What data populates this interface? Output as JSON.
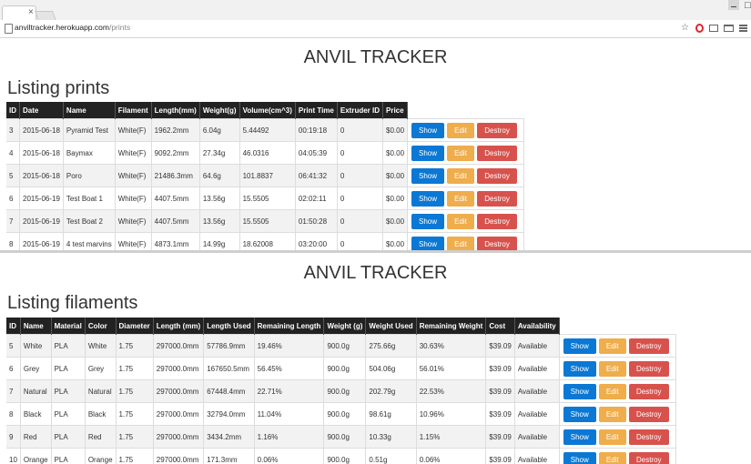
{
  "browser": {
    "url_host": "anviltracker.herokuapp.com",
    "url_path": "/prints",
    "tab_close": "×",
    "max_glyph": "□"
  },
  "prints_page": {
    "title": "ANVIL TRACKER",
    "heading": "Listing prints",
    "columns": [
      "ID",
      "Date",
      "Name",
      "Filament",
      "Length(mm)",
      "Weight(g)",
      "Volume(cm^3)",
      "Print Time",
      "Extruder ID",
      "Price"
    ],
    "rows": [
      [
        "3",
        "2015-06-18",
        "Pyramid Test",
        "White(F)",
        "1962.2mm",
        "6.04g",
        "5.44492",
        "00:19:18",
        "0",
        "$0.00"
      ],
      [
        "4",
        "2015-06-18",
        "Baymax",
        "White(F)",
        "9092.2mm",
        "27.34g",
        "46.0316",
        "04:05:39",
        "0",
        "$0.00"
      ],
      [
        "5",
        "2015-06-18",
        "Poro",
        "White(F)",
        "21486.3mm",
        "64.6g",
        "101.8837",
        "06:41:32",
        "0",
        "$0.00"
      ],
      [
        "6",
        "2015-06-19",
        "Test Boat 1",
        "White(F)",
        "4407.5mm",
        "13.56g",
        "15.5505",
        "02:02:11",
        "0",
        "$0.00"
      ],
      [
        "7",
        "2015-06-19",
        "Test Boat 2",
        "White(F)",
        "4407.5mm",
        "13.56g",
        "15.5505",
        "01:50:28",
        "0",
        "$0.00"
      ],
      [
        "8",
        "2015-06-19",
        "4 test marvins",
        "White(F)",
        "4873.1mm",
        "14.99g",
        "18.62008",
        "03:20:00",
        "0",
        "$0.00"
      ]
    ]
  },
  "filaments_page": {
    "title": "ANVIL TRACKER",
    "heading": "Listing filaments",
    "columns": [
      "ID",
      "Name",
      "Material",
      "Color",
      "Diameter",
      "Length (mm)",
      "Length Used",
      "Remaining Length",
      "Weight (g)",
      "Weight Used",
      "Remaining Weight",
      "Cost",
      "Availability"
    ],
    "rows": [
      [
        "5",
        "White",
        "PLA",
        "White",
        "1.75",
        "297000.0mm",
        "57786.9mm",
        "19.46%",
        "900.0g",
        "275.66g",
        "30.63%",
        "$39.09",
        "Available"
      ],
      [
        "6",
        "Grey",
        "PLA",
        "Grey",
        "1.75",
        "297000.0mm",
        "167650.5mm",
        "56.45%",
        "900.0g",
        "504.06g",
        "56.01%",
        "$39.09",
        "Available"
      ],
      [
        "7",
        "Natural",
        "PLA",
        "Natural",
        "1.75",
        "297000.0mm",
        "67448.4mm",
        "22.71%",
        "900.0g",
        "202.79g",
        "22.53%",
        "$39.09",
        "Available"
      ],
      [
        "8",
        "Black",
        "PLA",
        "Black",
        "1.75",
        "297000.0mm",
        "32794.0mm",
        "11.04%",
        "900.0g",
        "98.61g",
        "10.96%",
        "$39.09",
        "Available"
      ],
      [
        "9",
        "Red",
        "PLA",
        "Red",
        "1.75",
        "297000.0mm",
        "3434.2mm",
        "1.16%",
        "900.0g",
        "10.33g",
        "1.15%",
        "$39.09",
        "Available"
      ],
      [
        "10",
        "Orange",
        "PLA",
        "Orange",
        "1.75",
        "297000.0mm",
        "171.3mm",
        "0.06%",
        "900.0g",
        "0.51g",
        "0.06%",
        "$39.09",
        "Available"
      ]
    ]
  },
  "actions": {
    "show": "Show",
    "edit": "Edit",
    "destroy": "Destroy"
  },
  "colors": {
    "show": "#0a78d4",
    "edit": "#efad4c",
    "destroy": "#d8524d",
    "header": "#222222"
  }
}
